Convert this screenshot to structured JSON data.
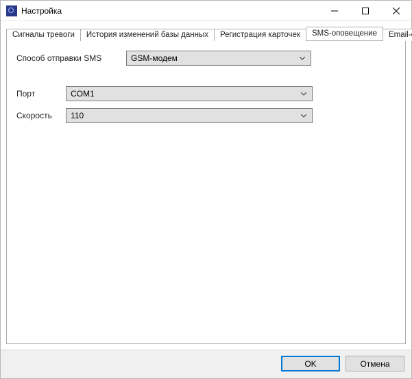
{
  "window": {
    "title": "Настройка"
  },
  "tabs": {
    "items": [
      {
        "label": "Сигналы тревоги"
      },
      {
        "label": "История изменений базы данных"
      },
      {
        "label": "Регистрация карточек"
      },
      {
        "label": "SMS-оповещение"
      },
      {
        "label": "Email-о"
      }
    ],
    "active_index": 3
  },
  "form": {
    "send_method": {
      "label": "Способ отправки SMS",
      "value": "GSM-модем"
    },
    "port": {
      "label": "Порт",
      "value": "COM1"
    },
    "speed": {
      "label": "Скорость",
      "value": "110"
    }
  },
  "buttons": {
    "ok": "OK",
    "cancel": "Отмена"
  }
}
